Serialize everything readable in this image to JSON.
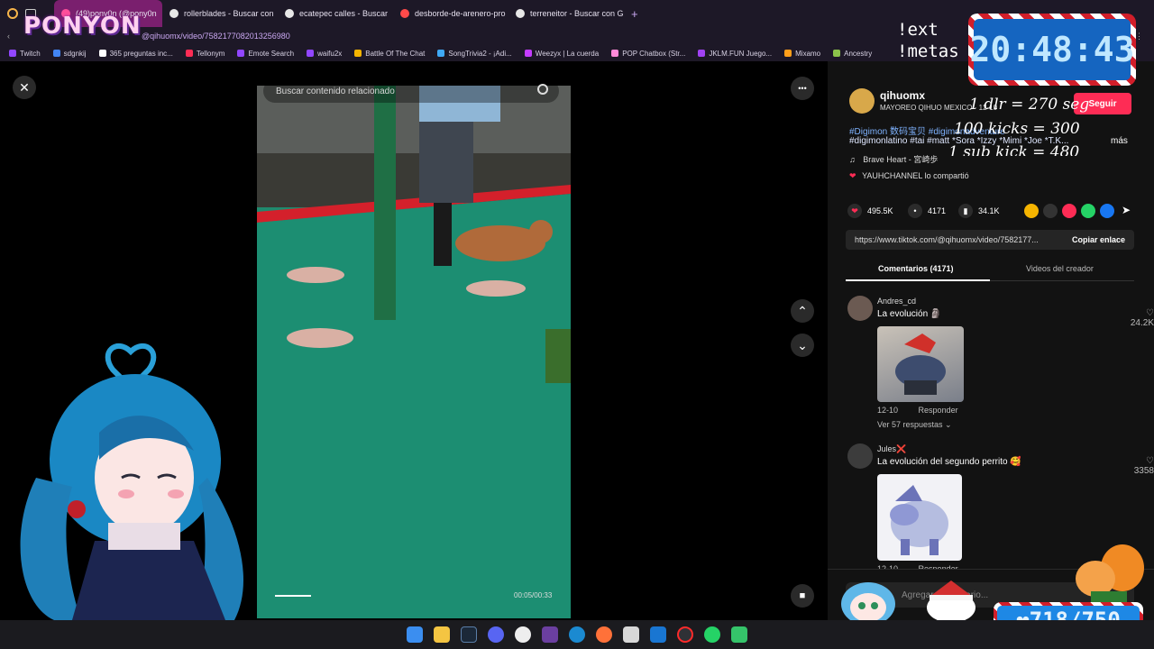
{
  "browser": {
    "tabs": [
      {
        "label": "(49)pony0n (@pony0n",
        "color": "#ff4f9a"
      },
      {
        "label": "rollerblades - Buscar con",
        "color": "#e7e7e7"
      },
      {
        "label": "ecatepec calles - Buscar",
        "color": "#e7e7e7"
      },
      {
        "label": "desborde-de-arenero-pro",
        "color": "#ff4a4a"
      },
      {
        "label": "terreneitor - Buscar con G",
        "color": "#e7e7e7"
      }
    ],
    "new_tab": "+",
    "address": "@qihuomx/video/7582177082013256980",
    "bookmarks": [
      {
        "label": "Twitch",
        "color": "#9146ff"
      },
      {
        "label": "sdgnkij",
        "color": "#4285f4"
      },
      {
        "label": "365 preguntas inc...",
        "color": "#ffffff"
      },
      {
        "label": "Tellonym",
        "color": "#ff2d55"
      },
      {
        "label": "Emote Search",
        "color": "#9146ff"
      },
      {
        "label": "waifu2x",
        "color": "#9146ff"
      },
      {
        "label": "Battle Of The Chat",
        "color": "#f5b400"
      },
      {
        "label": "SongTrivia2 - ¡Adi...",
        "color": "#3fa9f5"
      },
      {
        "label": "Weezyx | La cuerda",
        "color": "#c43cff"
      },
      {
        "label": "POP Chatbox (Str...",
        "color": "#ff8ad8"
      },
      {
        "label": "JKLM.FUN Juego...",
        "color": "#a142f4"
      },
      {
        "label": "Mixamo",
        "color": "#ff9f1a"
      },
      {
        "label": "Ancestry",
        "color": "#8bc34a"
      }
    ]
  },
  "overlay": {
    "logo": "PONYON",
    "clock": "20:48:43",
    "commands": [
      "!ext",
      "!metas"
    ],
    "goals": [
      "1 dlr = 270 seg",
      "100 kicks = 300",
      "1 sub kick = 480"
    ],
    "counter": "❤718/750"
  },
  "video": {
    "search_placeholder": "Buscar contenido relacionado",
    "timecode": "00:05/00:33",
    "close_icon": "✕",
    "more_icon": "•••"
  },
  "panel": {
    "username": "qihuomx",
    "subtitle": "MAYOREO QIHUO MEXICO · 12-10",
    "follow": "Seguir",
    "description": "#Digimon  数码宝贝 #digimonadventure",
    "description2": "#digimonlatino #tai #matt *Sora *Izzy *Mimi *Joe *T.K...",
    "more": "más",
    "music": "Brave Heart - 宮崎歩",
    "shared": "YAUHCHANNEL lo compartió",
    "stats": {
      "likes": "495.5K",
      "comments": "4171",
      "saves": "34.1K"
    },
    "share_colors": [
      "#f5b400",
      "#333333",
      "#fe2c55",
      "#25d366",
      "#1877f2"
    ],
    "link": "https://www.tiktok.com/@qihuomx/video/7582177...",
    "copy": "Copiar enlace",
    "tab_comments": "Comentarios (4171)",
    "tab_creator": "Videos del creador",
    "comments": [
      {
        "user": "Andres_cd",
        "text": "La evolución 🗿",
        "date": "12-10",
        "reply": "Responder",
        "likes": "24.2K",
        "more": "Ver 57 respuestas ⌄"
      },
      {
        "user": "Jules❌",
        "text": "La evolución del segundo perrito 🥰",
        "date": "12-10",
        "reply": "Responder",
        "likes": "3358"
      }
    ],
    "comment_placeholder": "Agregar comentario..."
  }
}
